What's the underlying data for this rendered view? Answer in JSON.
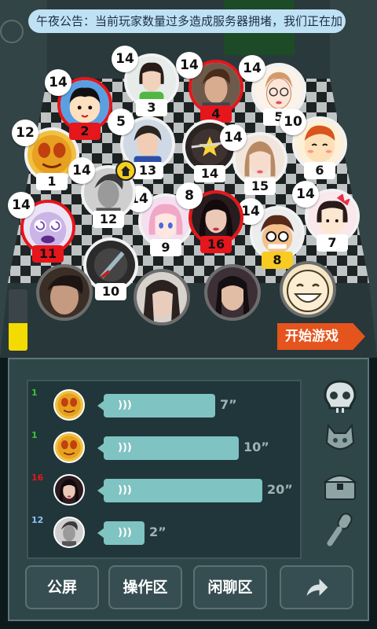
{
  "notice": "午夜公告：当前玩家数量过多造成服务器拥堵，我们正在加",
  "players": [
    {
      "name": "player-seat-1",
      "score": "12",
      "seat": "1",
      "seat_style": "white",
      "ring": "white",
      "pic": "cartoon-gold"
    },
    {
      "name": "player-seat-2",
      "score": "14",
      "seat": "2",
      "seat_style": "red",
      "ring": "red",
      "pic": "cartoon-boy"
    },
    {
      "name": "player-seat-3",
      "score": "14",
      "seat": "3",
      "seat_style": "white",
      "ring": "white",
      "pic": "girl-green"
    },
    {
      "name": "player-seat-4",
      "score": "14",
      "seat": "4",
      "seat_style": "red",
      "ring": "red",
      "pic": "man-photo"
    },
    {
      "name": "player-seat-5",
      "score": "14",
      "seat": "5",
      "seat_style": "white",
      "ring": "white",
      "pic": "sketch-girl"
    },
    {
      "name": "player-seat-6",
      "score": "10",
      "seat": "6",
      "seat_style": "white",
      "ring": "white",
      "pic": "cartoon-smile"
    },
    {
      "name": "player-seat-7",
      "score": "14",
      "seat": "7",
      "seat_style": "white",
      "ring": "white",
      "pic": "cartoon-bow"
    },
    {
      "name": "player-seat-8",
      "score": "14",
      "seat": "8",
      "seat_style": "gold",
      "ring": "white",
      "pic": "cartoon-glasses"
    },
    {
      "name": "player-seat-9",
      "score": "14",
      "seat": "9",
      "seat_style": "white",
      "ring": "white",
      "pic": "anime-girl"
    },
    {
      "name": "player-seat-10",
      "score": "",
      "seat": "10",
      "seat_style": "white",
      "ring": "white",
      "pic": "dark-blade"
    },
    {
      "name": "player-seat-11",
      "score": "14",
      "seat": "11",
      "seat_style": "red",
      "ring": "red",
      "pic": "cartoon-swirl"
    },
    {
      "name": "player-seat-12",
      "score": "14",
      "seat": "12",
      "seat_style": "white",
      "ring": "white",
      "pic": "man-bw"
    },
    {
      "name": "player-seat-13",
      "score": "5",
      "seat": "13",
      "seat_style": "white",
      "ring": "white",
      "pic": "boy-photo"
    },
    {
      "name": "player-seat-14",
      "score": "",
      "seat": "14",
      "seat_style": "white",
      "ring": "white",
      "pic": "dark-star"
    },
    {
      "name": "player-seat-15",
      "score": "14",
      "seat": "15",
      "seat_style": "white",
      "ring": "white",
      "pic": "girl-photo"
    },
    {
      "name": "player-seat-16",
      "score": "8",
      "seat": "16",
      "seat_style": "red",
      "ring": "red",
      "pic": "girl-dark"
    }
  ],
  "meter_level": 0.45,
  "start_button": "开始游戏",
  "messages": [
    {
      "seat": "1",
      "seat_color": "#39c534",
      "pic": "cartoon-gold",
      "duration": "7”",
      "bubble_w": 142
    },
    {
      "seat": "1",
      "seat_color": "#39c534",
      "pic": "cartoon-gold",
      "duration": "10”",
      "bubble_w": 172
    },
    {
      "seat": "16",
      "seat_color": "#e5161c",
      "pic": "girl-dark",
      "duration": "20”",
      "bubble_w": 202
    },
    {
      "seat": "12",
      "seat_color": "#8fc3ff",
      "pic": "man-bw",
      "duration": "2”",
      "bubble_w": 52
    }
  ],
  "side_icons": [
    "skull-icon",
    "cat-icon",
    "chest-icon",
    "microphone-icon"
  ],
  "tabs": [
    "公屏",
    "操作区",
    "闲聊区"
  ],
  "colors": {
    "accent": "#e5541d",
    "danger": "#e5161c",
    "gold": "#f7cb22",
    "bubble": "#7fc3c2"
  }
}
